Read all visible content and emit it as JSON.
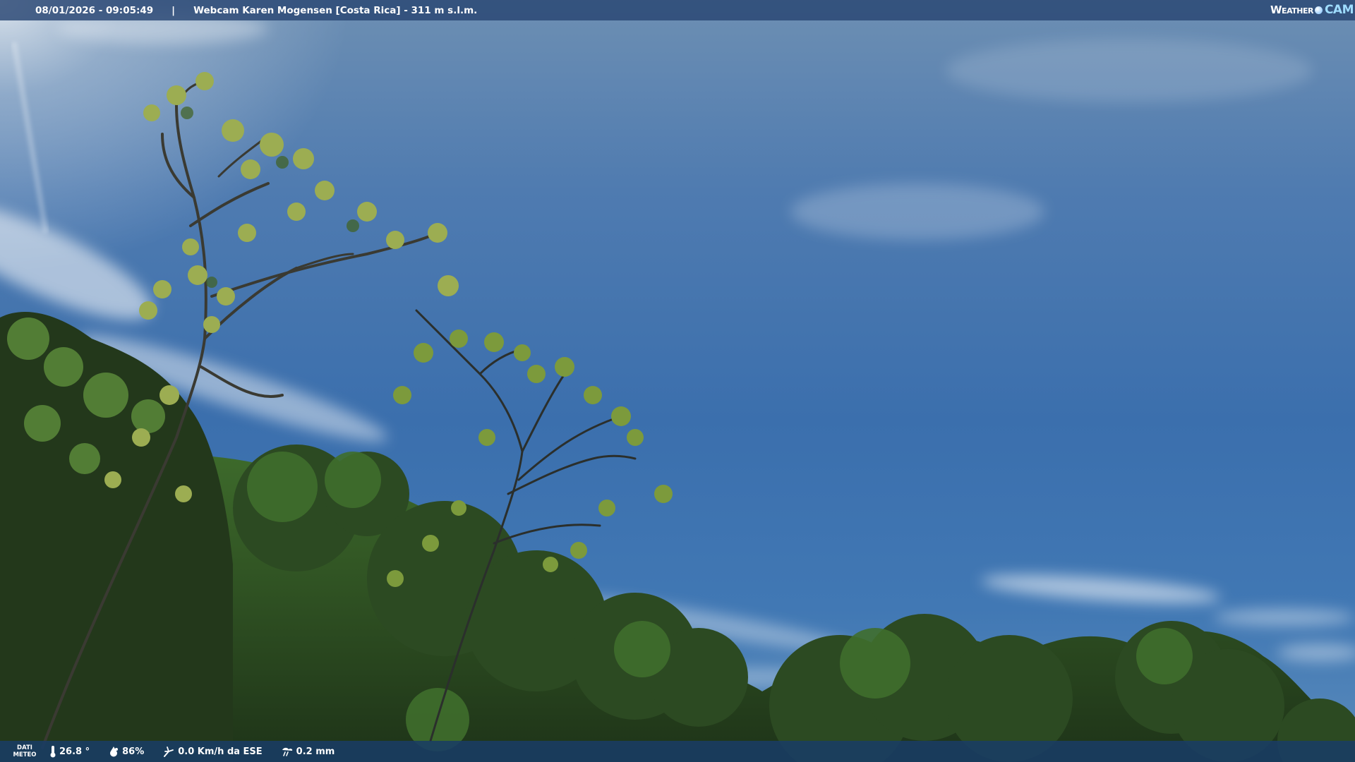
{
  "header": {
    "datetime": "08/01/2026 - 09:05:49",
    "separator": "|",
    "location": "Webcam Karen Mogensen [Costa Rica]  - 311 m s.l.m."
  },
  "logo": {
    "weather": "Weather",
    "cam": "CAM"
  },
  "footer": {
    "label_line1": "DATI",
    "label_line2": "METEO",
    "temperature": "26.8 °",
    "humidity": "86%",
    "wind": "0.0 Km/h da ESE",
    "rain": "0.2 mm"
  },
  "icons": {
    "temperature": "thermometer-icon",
    "humidity": "droplet-icon",
    "wind": "wind-icon",
    "rain": "rain-cloud-icon"
  },
  "colors": {
    "sky_top": "#6d8fb3",
    "sky_mid": "#3b6fad",
    "foliage": "#2f4f25",
    "bar": "#28466f"
  }
}
